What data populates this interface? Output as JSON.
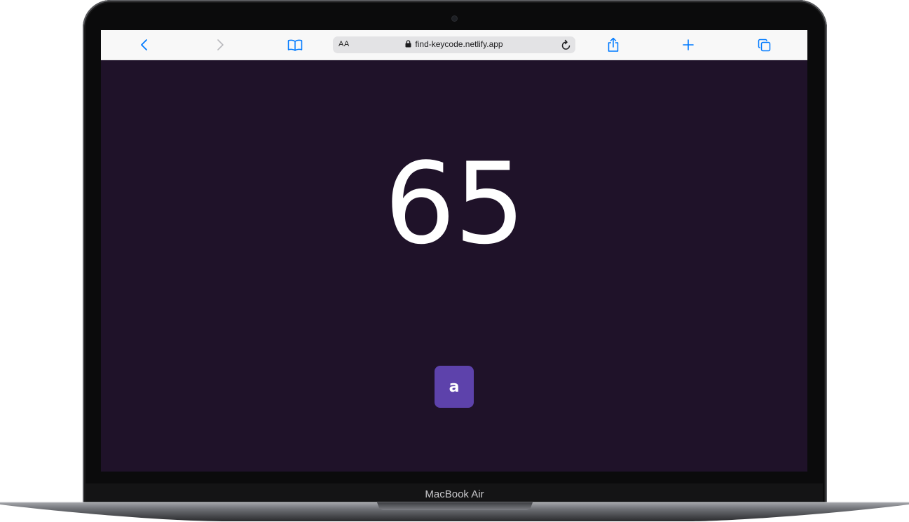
{
  "browser": {
    "reader_label": "AA",
    "url": "find-keycode.netlify.app",
    "icons": [
      "back-icon",
      "forward-icon",
      "bookmarks-icon",
      "lock-icon",
      "reload-icon",
      "share-icon",
      "new-tab-icon",
      "tabs-icon"
    ],
    "accent_color": "#007aff"
  },
  "page": {
    "keycode": "65",
    "key": "a",
    "background_color": "#1f1229",
    "key_color": "#5d42ab"
  },
  "device": {
    "brand_label": "MacBook Air"
  }
}
